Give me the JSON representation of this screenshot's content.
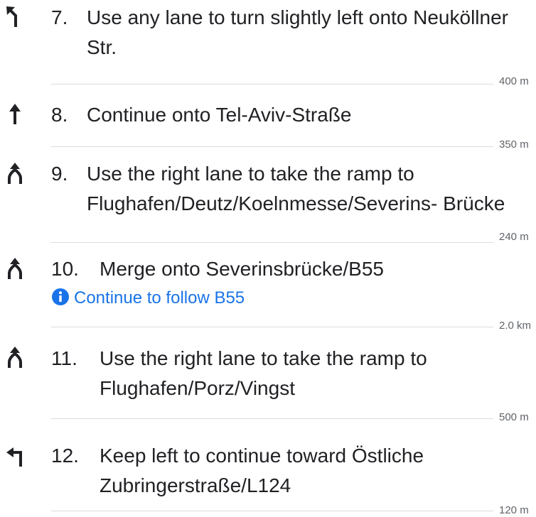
{
  "steps": [
    {
      "number": "7.",
      "icon": "turn-slight-left-icon",
      "lines": [
        "Use any lane to turn slightly left onto Neuköllner",
        "Str."
      ],
      "distance": "400 m"
    },
    {
      "number": "8.",
      "icon": "straight-arrow-icon",
      "lines": [
        "Continue onto Tel-Aviv-Straße"
      ],
      "distance": "350 m"
    },
    {
      "number": "9.",
      "icon": "ramp-right-icon",
      "lines": [
        "Use the right lane to take the ramp to",
        "Flughafen/Deutz/Koelnmesse/Severins- Brücke"
      ],
      "distance": "240 m"
    },
    {
      "number": "10.",
      "icon": "merge-icon",
      "lines": [
        "Merge onto Severinsbrücke/B55"
      ],
      "note": "Continue to follow B55",
      "note_icon": "info-icon",
      "distance": "2.0 km"
    },
    {
      "number": "11.",
      "icon": "ramp-right-icon",
      "lines": [
        "Use the right lane to take the ramp to",
        "Flughafen/Porz/Vingst"
      ],
      "distance": "500 m"
    },
    {
      "number": "12.",
      "icon": "keep-left-icon",
      "lines": [
        "Keep left to continue toward Östliche",
        "Zubringerstraße/L124"
      ],
      "distance": "120 m"
    }
  ],
  "colors": {
    "text": "#202124",
    "icon": "#202124",
    "link": "#1a73e8",
    "divider": "#dadce0",
    "distance": "#5f6368"
  }
}
